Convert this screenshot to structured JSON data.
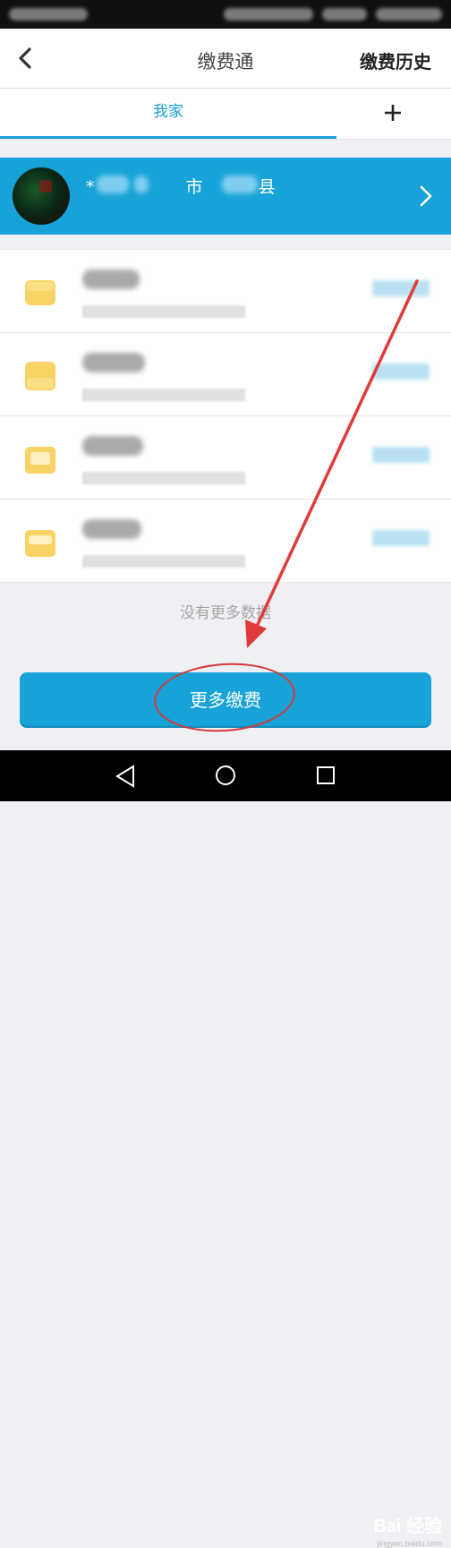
{
  "header": {
    "title": "缴费通",
    "history_label": "缴费历史"
  },
  "tabs": {
    "home_label": "我家",
    "add_label": "+"
  },
  "account": {
    "location_prefix": "*",
    "location_city": "市",
    "location_county": "县"
  },
  "list": {
    "items": [
      {
        "icon": "water-bill-icon"
      },
      {
        "icon": "electricity-bill-icon"
      },
      {
        "icon": "gas-bill-icon"
      },
      {
        "icon": "utility-bill-icon"
      }
    ],
    "empty_text": "没有更多数据"
  },
  "footer": {
    "more_button_label": "更多缴费"
  },
  "watermark": {
    "brand": "Bai 经验",
    "site": "jingyan.baidu.com"
  },
  "colors": {
    "accent": "#17a3d8",
    "annotation_red": "#d23a3a"
  }
}
